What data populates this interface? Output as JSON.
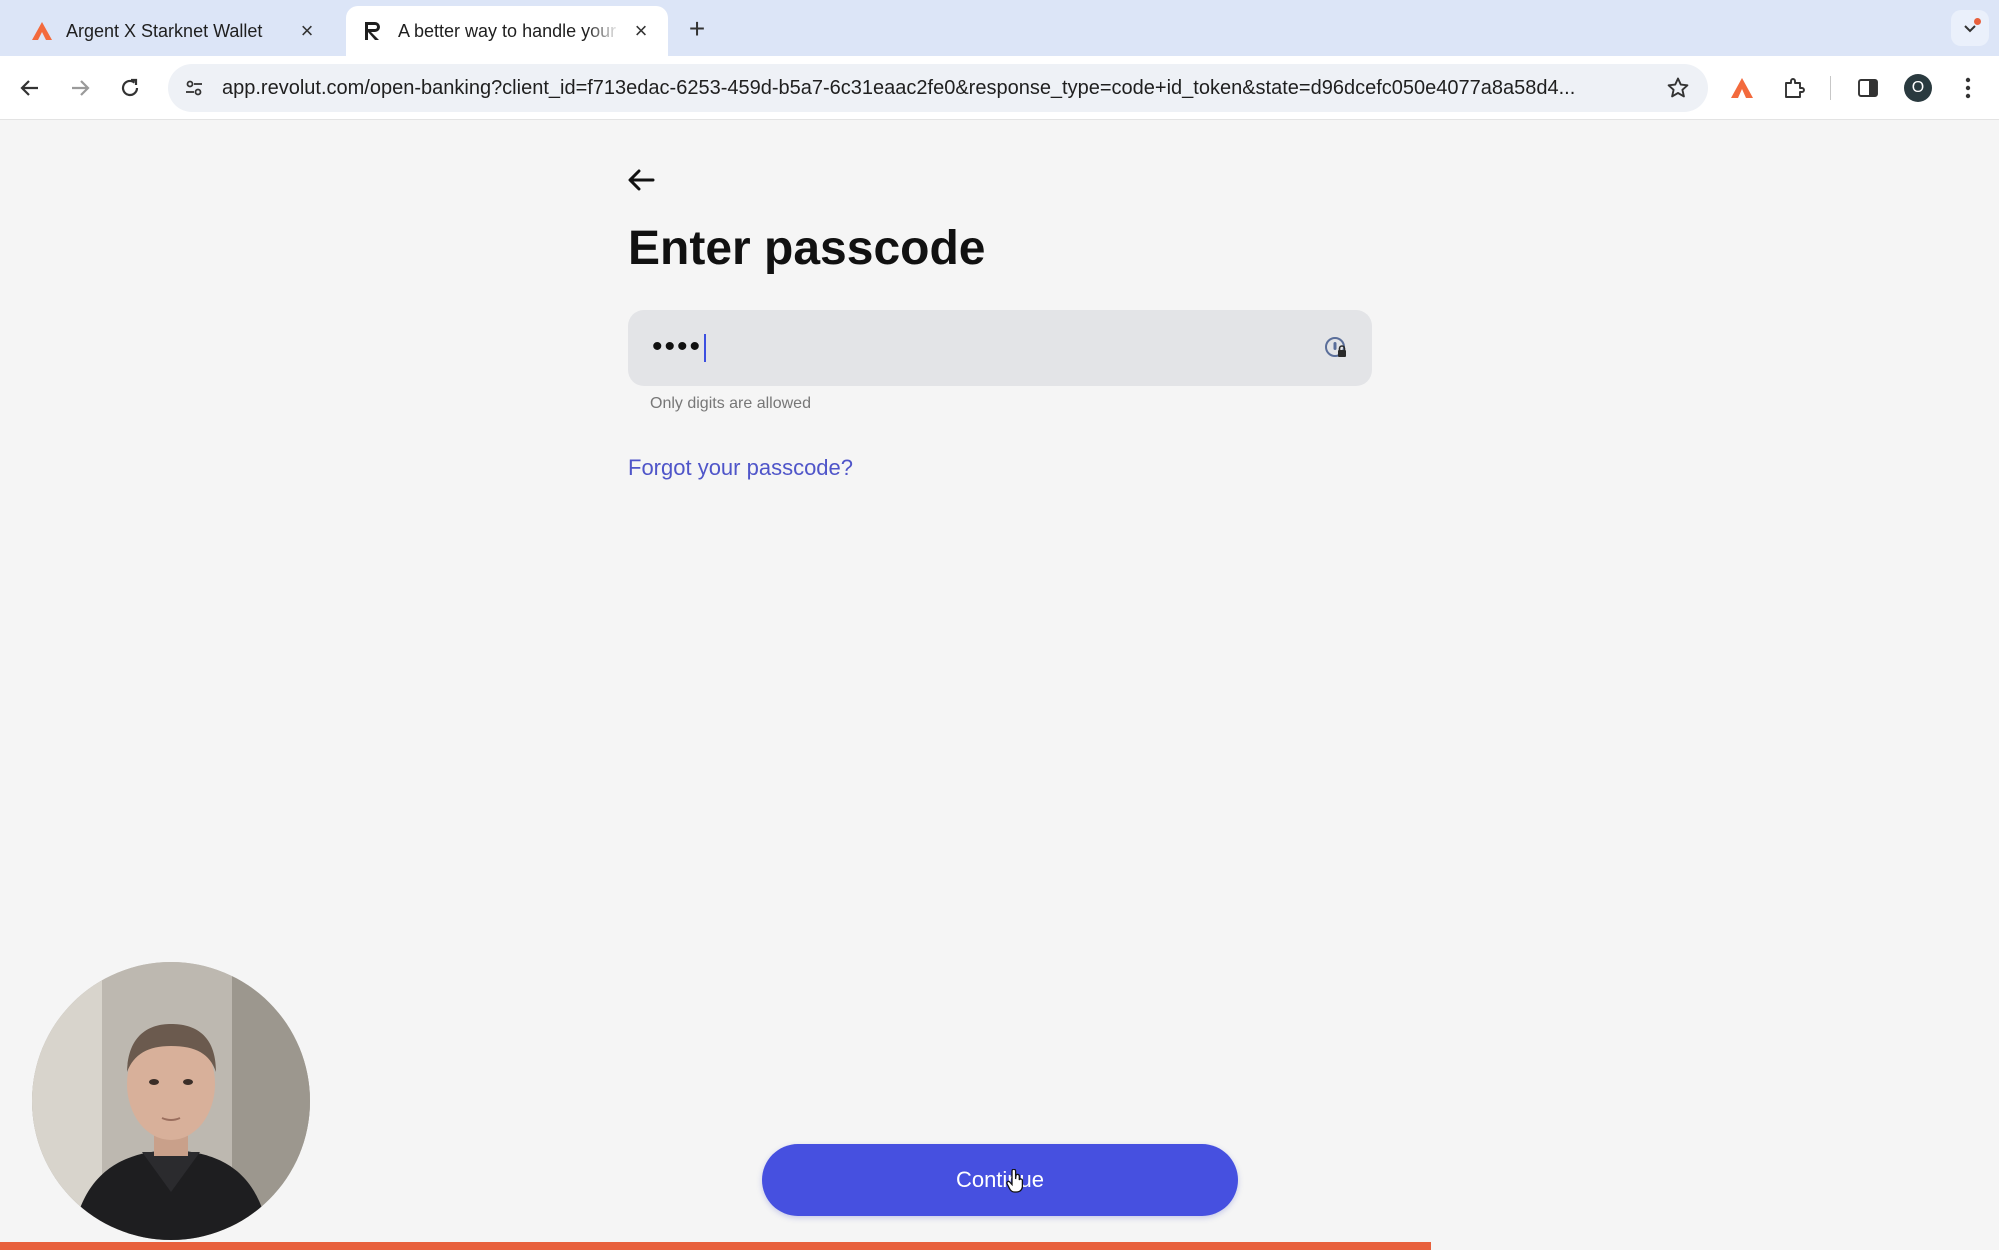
{
  "browser": {
    "tabs": [
      {
        "title": "Argent X Starknet Wallet",
        "active": false
      },
      {
        "title": "A better way to handle your m",
        "active": true
      }
    ],
    "url": "app.revolut.com/open-banking?client_id=f713edac-6253-459d-b5a7-6c31eaac2fe0&response_type=code+id_token&state=d96dcefc050e4077a8a58d4...",
    "profile_initial": "O"
  },
  "page": {
    "title": "Enter passcode",
    "passcode_masked": "••••",
    "hint": "Only digits are allowed",
    "forgot_link": "Forgot your passcode?",
    "continue_label": "Continue"
  },
  "page_load_progress": 0.716,
  "colors": {
    "accent": "#4650e0",
    "link": "#4f55c9",
    "progress": "#e8603c",
    "tabstrip": "#dce5f7"
  }
}
